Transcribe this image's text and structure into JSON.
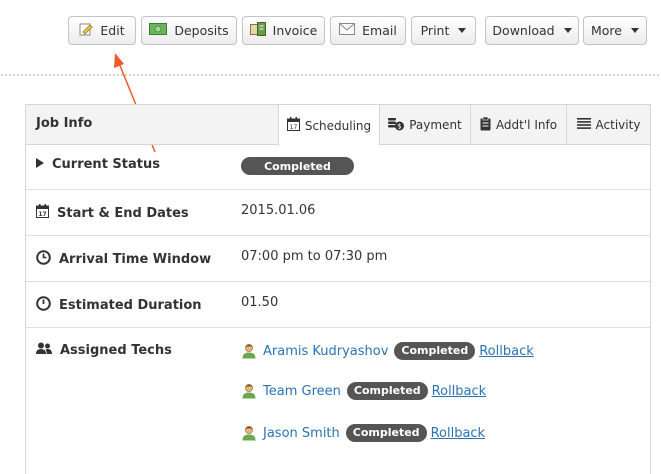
{
  "toolbar": {
    "edit_label": "Edit",
    "deposits_label": "Deposits",
    "invoice_label": "Invoice",
    "email_label": "Email",
    "print_label": "Print",
    "download_label": "Download",
    "more_label": "More"
  },
  "panel": {
    "title": "Job Info",
    "tabs": [
      {
        "label": "Scheduling",
        "icon": "calendar-icon",
        "active": true
      },
      {
        "label": "Payment",
        "icon": "coins-icon",
        "active": false
      },
      {
        "label": "Addt'l Info",
        "icon": "clipboard-icon",
        "active": false
      },
      {
        "label": "Activity",
        "icon": "list-icon",
        "active": false
      }
    ]
  },
  "rows": {
    "current_status": {
      "label": "Current Status",
      "value": "Completed"
    },
    "dates": {
      "label": "Start & End Dates",
      "value": "2015.01.06"
    },
    "arrival": {
      "label": "Arrival Time Window",
      "value": "07:00 pm to 07:30 pm"
    },
    "duration": {
      "label": "Estimated Duration",
      "value": "01.50"
    },
    "techs": {
      "label": "Assigned Techs",
      "items": [
        {
          "name": "Aramis Kudryashov",
          "status": "Completed",
          "action": "Rollback"
        },
        {
          "name": "Team Green",
          "status": "Completed",
          "action": "Rollback"
        },
        {
          "name": "Jason Smith",
          "status": "Completed",
          "action": "Rollback"
        }
      ]
    }
  },
  "colors": {
    "link": "#2a73b5",
    "badge_bg": "#555555",
    "annotation_arrow": "#f05a28"
  }
}
